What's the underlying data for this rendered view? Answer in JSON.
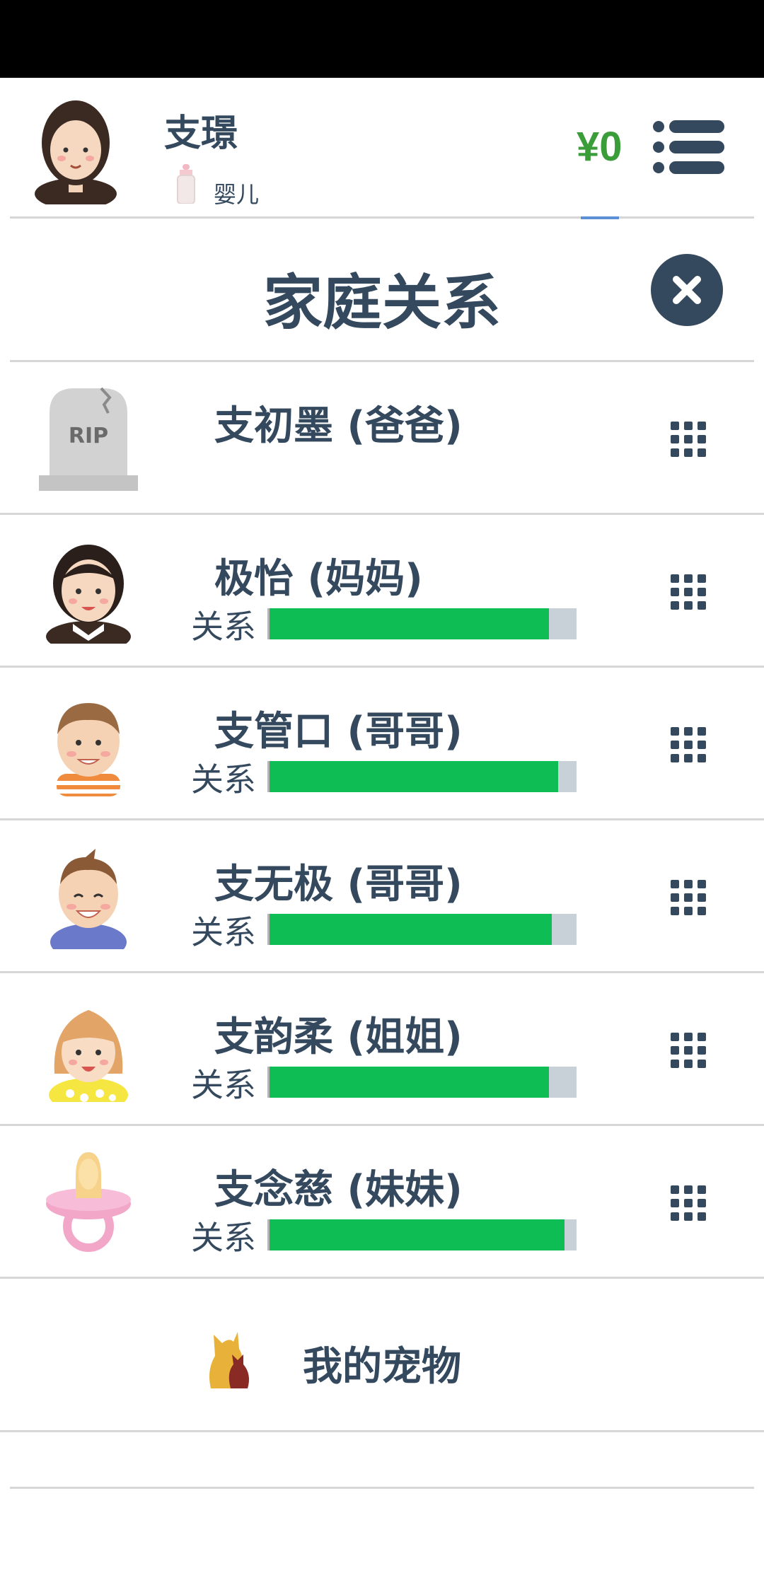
{
  "player": {
    "name": "支璟",
    "stage": "婴儿",
    "money": "¥0"
  },
  "dialog": {
    "title": "家庭关系"
  },
  "relatives": [
    {
      "name": "支初墨 (爸爸)",
      "deceased": true,
      "relation_label": "",
      "relation_level": null,
      "portrait": "tombstone-rip-icon"
    },
    {
      "name": "极怡 (妈妈)",
      "deceased": false,
      "relation_label": "关系",
      "relation_level": 0.91,
      "portrait": "mother-avatar"
    },
    {
      "name": "支管口 (哥哥)",
      "deceased": false,
      "relation_label": "关系",
      "relation_level": 0.94,
      "portrait": "brother-avatar"
    },
    {
      "name": "支无极 (哥哥)",
      "deceased": false,
      "relation_label": "关系",
      "relation_level": 0.92,
      "portrait": "brother-avatar"
    },
    {
      "name": "支韵柔 (姐姐)",
      "deceased": false,
      "relation_label": "关系",
      "relation_level": 0.91,
      "portrait": "sister-avatar"
    },
    {
      "name": "支念慈 (妹妹)",
      "deceased": false,
      "relation_label": "关系",
      "relation_level": 0.96,
      "portrait": "pacifier-icon"
    }
  ],
  "pets": {
    "label": "我的宠物"
  },
  "colors": {
    "relation_bar": "#0fbd55",
    "bar_track": "#c8d0d8",
    "money": "#3a9d3a",
    "text": "#34495e"
  }
}
